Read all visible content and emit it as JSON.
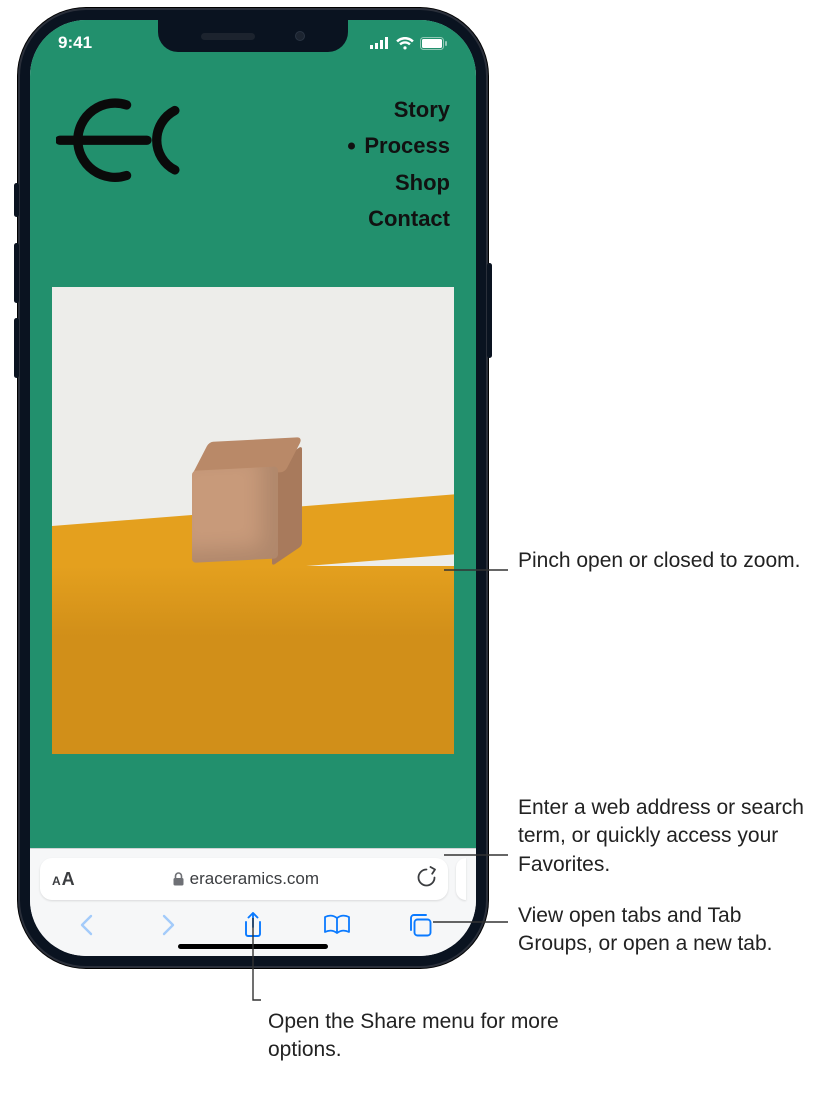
{
  "status": {
    "time": "9:41"
  },
  "site": {
    "nav": {
      "items": [
        "Story",
        "Process",
        "Shop",
        "Contact"
      ],
      "selected_index": 1
    }
  },
  "safari": {
    "address": "eraceramics.com",
    "aa_small": "A",
    "aa_big": "A",
    "toolbar": {
      "back": "back-button",
      "forward": "forward-button",
      "share": "share-button",
      "bookmarks": "bookmarks-button",
      "tabs": "tabs-button"
    }
  },
  "callouts": {
    "zoom": "Pinch open or closed to zoom.",
    "address": "Enter a web address or search term, or quickly access your Favorites.",
    "tabs": "View open tabs and Tab Groups, or open a new tab.",
    "share": "Open the Share menu for more options."
  }
}
